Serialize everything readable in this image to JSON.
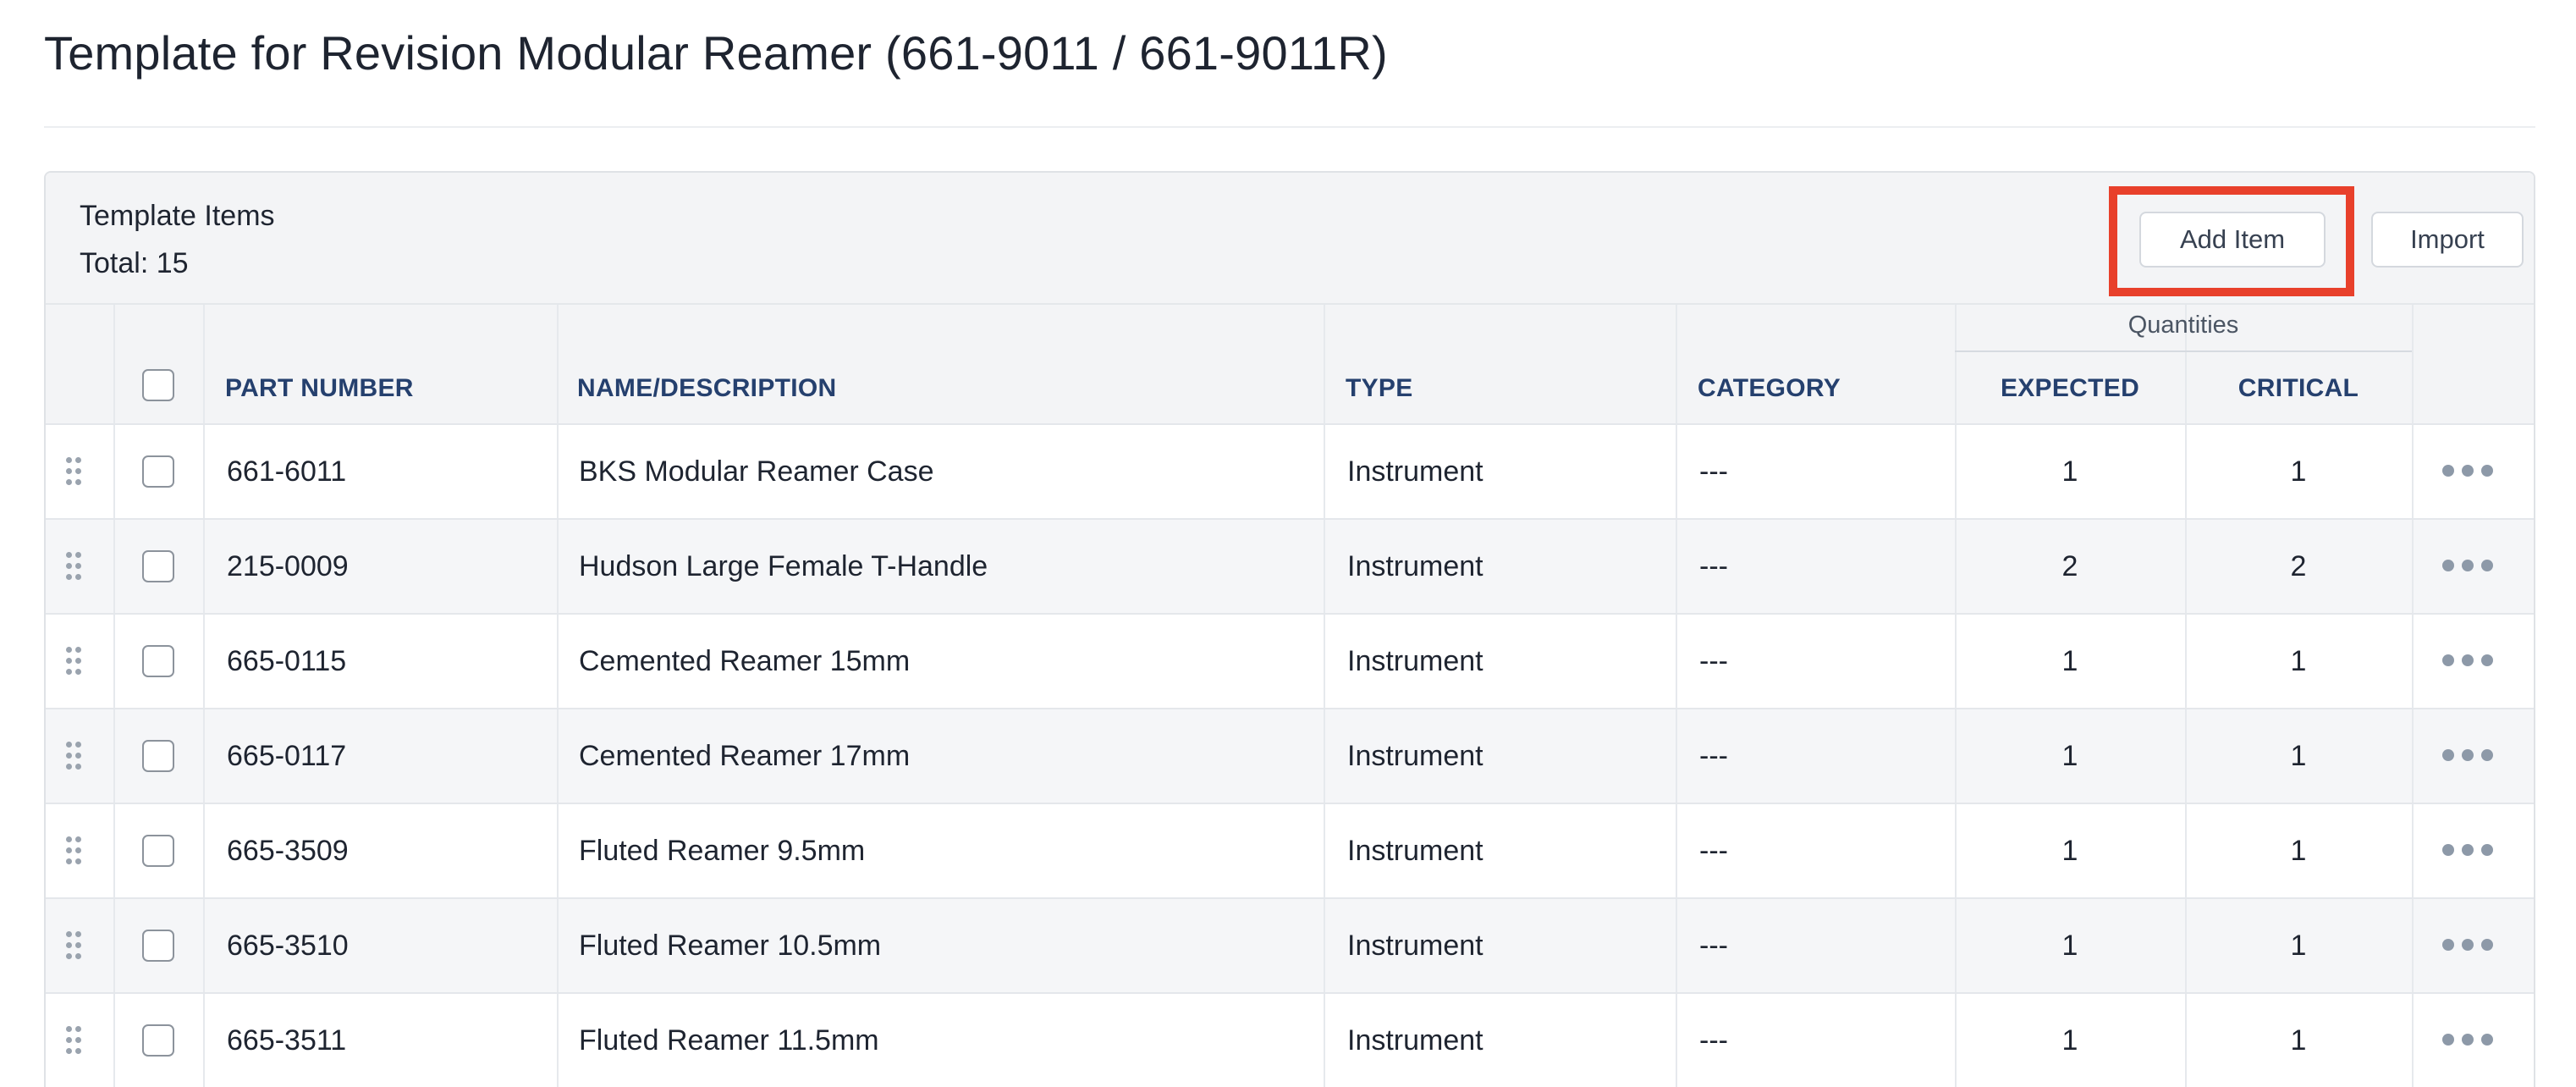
{
  "page": {
    "title": "Template for Revision Modular Reamer (661-9011 / 661-9011R)"
  },
  "panel": {
    "title": "Template Items",
    "total": "Total: 15",
    "add_item_label": "Add Item",
    "import_label": "Import",
    "highlight_color": "#e8402b"
  },
  "table": {
    "group_header": "Quantities",
    "headers": {
      "part_number": "PART NUMBER",
      "name": "NAME/DESCRIPTION",
      "type": "TYPE",
      "category": "CATEGORY",
      "expected": "EXPECTED",
      "critical": "CRITICAL"
    },
    "rows": [
      {
        "part_number": "661-6011",
        "name": "BKS Modular Reamer Case",
        "type": "Instrument",
        "category": "---",
        "expected": "1",
        "critical": "1"
      },
      {
        "part_number": "215-0009",
        "name": "Hudson Large Female T-Handle",
        "type": "Instrument",
        "category": "---",
        "expected": "2",
        "critical": "2"
      },
      {
        "part_number": "665-0115",
        "name": "Cemented Reamer 15mm",
        "type": "Instrument",
        "category": "---",
        "expected": "1",
        "critical": "1"
      },
      {
        "part_number": "665-0117",
        "name": "Cemented Reamer 17mm",
        "type": "Instrument",
        "category": "---",
        "expected": "1",
        "critical": "1"
      },
      {
        "part_number": "665-3509",
        "name": "Fluted Reamer 9.5mm",
        "type": "Instrument",
        "category": "---",
        "expected": "1",
        "critical": "1"
      },
      {
        "part_number": "665-3510",
        "name": "Fluted Reamer 10.5mm",
        "type": "Instrument",
        "category": "---",
        "expected": "1",
        "critical": "1"
      },
      {
        "part_number": "665-3511",
        "name": "Fluted Reamer 11.5mm",
        "type": "Instrument",
        "category": "---",
        "expected": "1",
        "critical": "1"
      }
    ]
  },
  "icons": {
    "drag": "drag-handle-icon",
    "more": "more-options-icon"
  },
  "colors": {
    "header_text": "#25406e",
    "header_bg": "#f3f4f6",
    "row_alt_bg": "#f5f6f8"
  }
}
